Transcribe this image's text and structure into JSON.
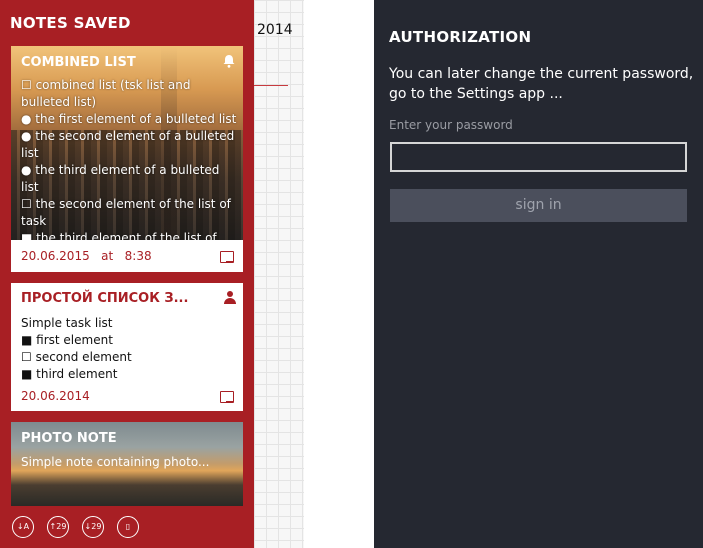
{
  "left_app": {
    "title": "NOTES SAVED",
    "notes": [
      {
        "title": "COMBINED LIST",
        "lines": [
          "☐ combined list (tsk list and bulleted list)",
          "● the first element of a bulleted list",
          "● the second element of a bulleted list",
          "● the third element of a bulleted list",
          "☐ the second element of the list of task",
          "■ the third element of the list of task"
        ],
        "date": "20.06.2015   at   8:38",
        "icon": "bell-icon"
      },
      {
        "title": "ПРОСТОЙ СПИСОК З...",
        "lines": [
          "Simple task list",
          "■ first element",
          "☐ second element",
          "■ third element"
        ],
        "date": "20.06.2014",
        "icon": "person-icon"
      },
      {
        "title": "PHOTO NOTE",
        "subtitle": "Simple note containing photo..."
      }
    ],
    "appbar": [
      {
        "icon": "sort-alpha-icon",
        "glyph": "↓A"
      },
      {
        "icon": "sort-date-asc-icon",
        "glyph": "↑29"
      },
      {
        "icon": "sort-date-desc-icon",
        "glyph": "↓29"
      },
      {
        "icon": "phone-icon",
        "glyph": "▯"
      }
    ]
  },
  "middle": {
    "year": "2014"
  },
  "auth": {
    "title": "AUTHORIZATION",
    "description": "You can later change the current password, go to the Settings app ...",
    "password_label": "Enter your password",
    "password_value": "",
    "signin_label": "sign in"
  },
  "colors": {
    "accent_red": "#a81f24",
    "auth_background": "#252831",
    "button_background": "#4b4f5c"
  }
}
